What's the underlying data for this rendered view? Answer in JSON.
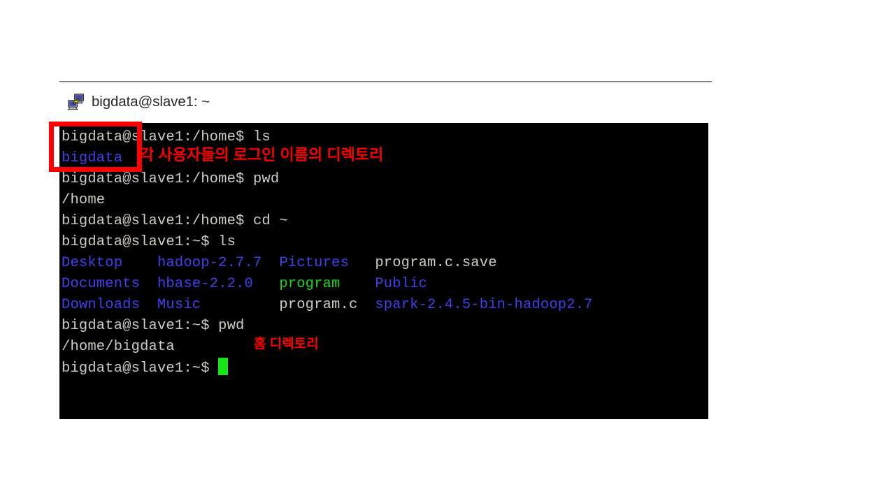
{
  "window": {
    "icon": "putty-terminal-icon",
    "title": "bigdata@slave1: ~"
  },
  "terminal": {
    "background_color": "#000000",
    "foreground_color": "#cfcbc3",
    "dir_color": "#4040ef",
    "exec_color": "#19d619",
    "cursor_color": "#19e619",
    "lines": [
      {
        "id": "l1",
        "segments": [
          {
            "text": "bigdata@slave1:/home$ ls",
            "color": "white"
          }
        ]
      },
      {
        "id": "l2",
        "segments": [
          {
            "text": "bigdata",
            "color": "blue"
          }
        ]
      },
      {
        "id": "l3",
        "segments": [
          {
            "text": "bigdata@slave1:/home$ pwd",
            "color": "white"
          }
        ]
      },
      {
        "id": "l4",
        "segments": [
          {
            "text": "/home",
            "color": "white"
          }
        ]
      },
      {
        "id": "l5",
        "segments": [
          {
            "text": "bigdata@slave1:/home$ cd ~",
            "color": "white"
          }
        ]
      },
      {
        "id": "l6",
        "segments": [
          {
            "text": "bigdata@slave1:~$ ls",
            "color": "white"
          }
        ]
      },
      {
        "id": "l7",
        "segments": [
          {
            "text": "Desktop",
            "color": "blue"
          },
          {
            "text": "    ",
            "color": "white"
          },
          {
            "text": "hadoop-2.7.7",
            "color": "blue"
          },
          {
            "text": "  ",
            "color": "white"
          },
          {
            "text": "Pictures",
            "color": "blue"
          },
          {
            "text": "   ",
            "color": "white"
          },
          {
            "text": "program.c.save",
            "color": "white"
          }
        ]
      },
      {
        "id": "l8",
        "segments": [
          {
            "text": "Documents",
            "color": "blue"
          },
          {
            "text": "  ",
            "color": "white"
          },
          {
            "text": "hbase-2.2.0",
            "color": "blue"
          },
          {
            "text": "   ",
            "color": "white"
          },
          {
            "text": "program",
            "color": "green"
          },
          {
            "text": "    ",
            "color": "white"
          },
          {
            "text": "Public",
            "color": "blue"
          }
        ]
      },
      {
        "id": "l9",
        "segments": [
          {
            "text": "Downloads",
            "color": "blue"
          },
          {
            "text": "  ",
            "color": "white"
          },
          {
            "text": "Music",
            "color": "blue"
          },
          {
            "text": "         ",
            "color": "white"
          },
          {
            "text": "program.c",
            "color": "white"
          },
          {
            "text": "  ",
            "color": "white"
          },
          {
            "text": "spark-2.4.5-bin-hadoop2.7",
            "color": "blue"
          }
        ]
      },
      {
        "id": "l10",
        "segments": [
          {
            "text": "bigdata@slave1:~$ pwd",
            "color": "white"
          }
        ]
      },
      {
        "id": "l11",
        "segments": [
          {
            "text": "/home/bigdata",
            "color": "white"
          }
        ]
      },
      {
        "id": "l12",
        "segments": [
          {
            "text": "bigdata@slave1:~$ ",
            "color": "white"
          },
          {
            "text": "",
            "color": "cursor"
          }
        ]
      }
    ]
  },
  "annotations": {
    "highlight_color": "#ff0000",
    "users_note": "각 사용자들의 로그인 이름의 디렉토리",
    "home_note": "홈 디렉토리"
  }
}
